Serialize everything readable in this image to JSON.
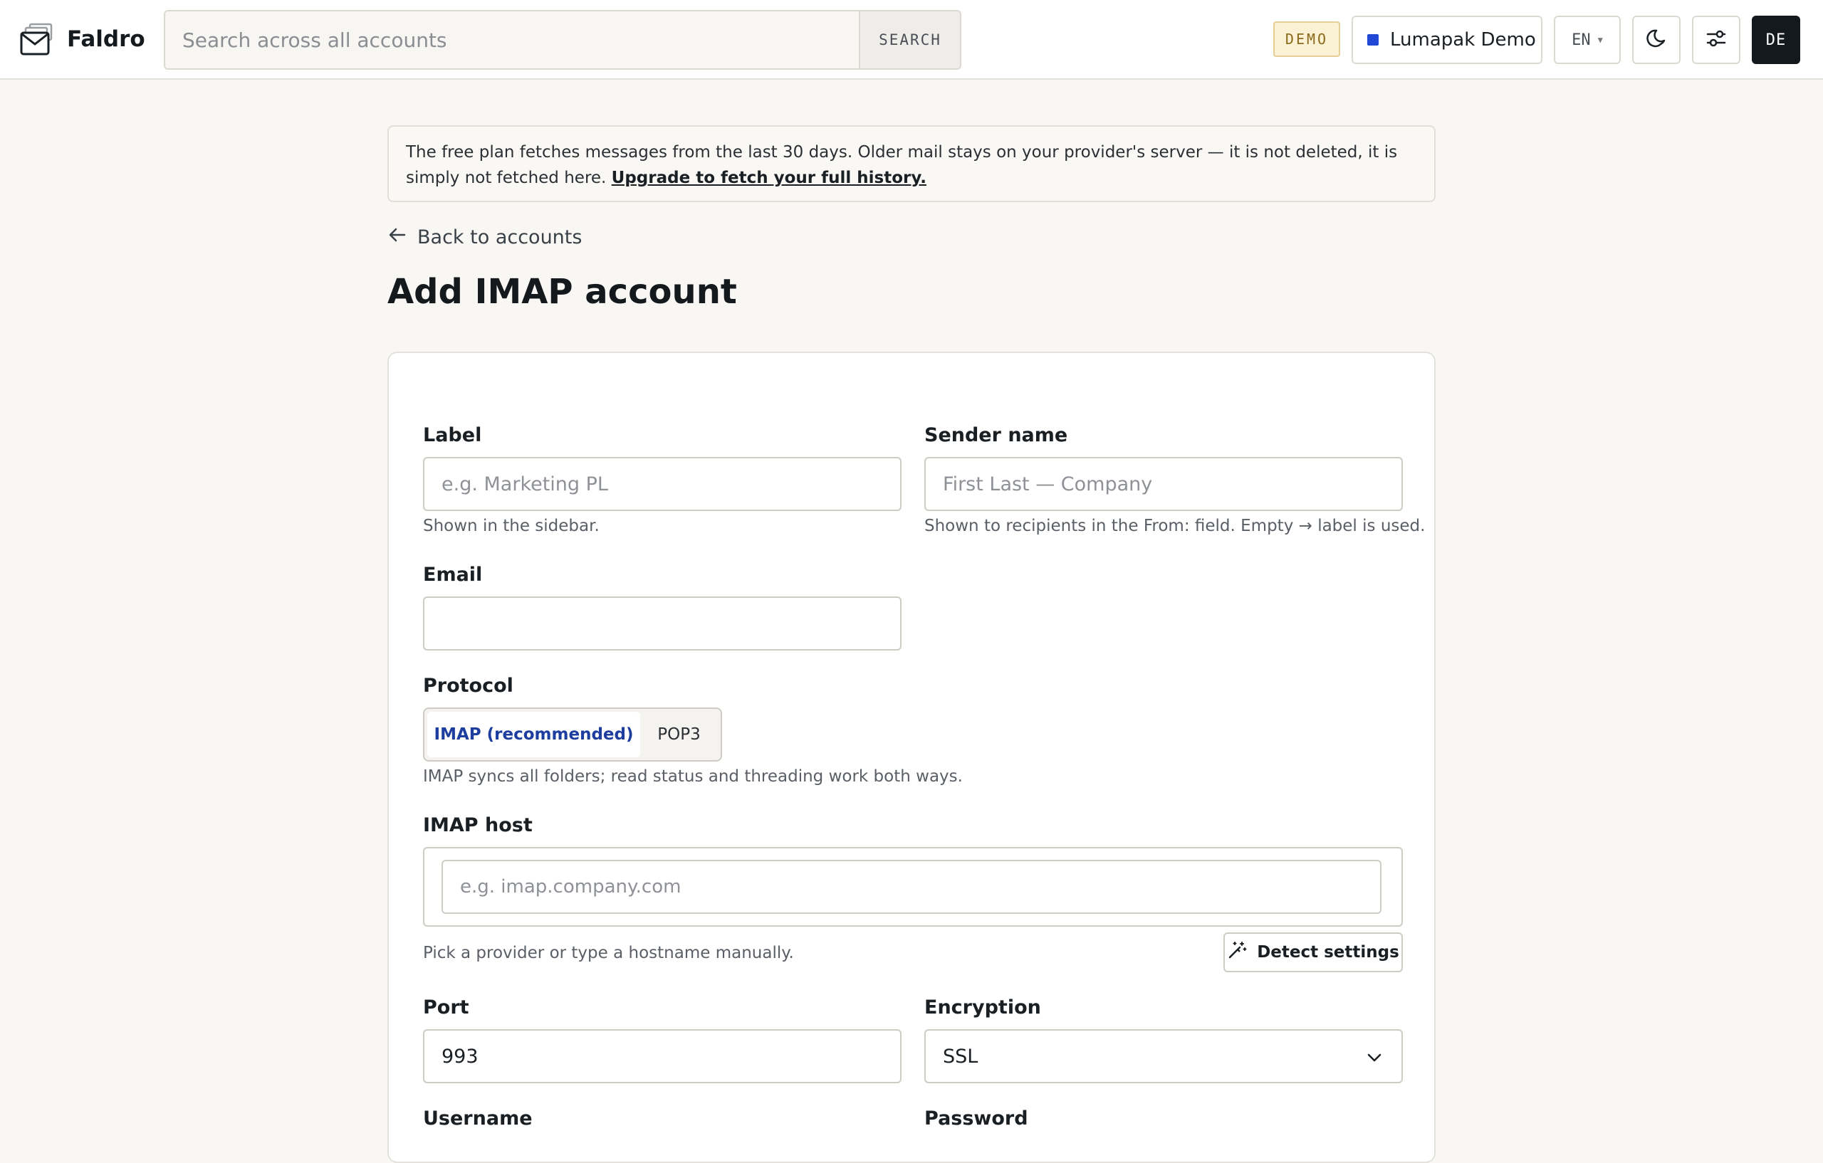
{
  "app": {
    "name": "Faldro"
  },
  "search": {
    "placeholder": "Search across all accounts",
    "button_label": "SEARCH"
  },
  "header": {
    "demo_badge": "DEMO",
    "account": {
      "name": "Lumapak Demo",
      "color": "#1f48d6"
    },
    "language": "EN",
    "avatar_initials": "DE",
    "icons": [
      "mail-logo-icon",
      "moon-icon",
      "sliders-icon",
      "chevron-down-icon"
    ]
  },
  "notice": {
    "text": "The free plan fetches messages from the last 30 days. Older mail stays on your provider's server — it is not deleted, it is simply not fetched here.",
    "link": "Upgrade to fetch your full history."
  },
  "nav": {
    "back_label": "Back to accounts"
  },
  "page": {
    "title": "Add IMAP account"
  },
  "form": {
    "label": {
      "label": "Label",
      "placeholder": "e.g. Marketing PL",
      "help": "Shown in the sidebar."
    },
    "sender_name": {
      "label": "Sender name",
      "placeholder": "First Last — Company",
      "help": "Shown to recipients in the From: field. Empty → label is used."
    },
    "email": {
      "label": "Email",
      "value": ""
    },
    "protocol": {
      "label": "Protocol",
      "options": [
        "IMAP (recommended)",
        "POP3"
      ],
      "selected": "IMAP (recommended)",
      "help": "IMAP syncs all folders; read status and threading work both ways."
    },
    "imap_host": {
      "label": "IMAP host",
      "placeholder": "e.g. imap.company.com",
      "help": "Pick a provider or type a hostname manually.",
      "detect_label": "Detect settings"
    },
    "port": {
      "label": "Port",
      "value": "993"
    },
    "encryption": {
      "label": "Encryption",
      "value": "SSL"
    },
    "username": {
      "label": "Username"
    },
    "password": {
      "label": "Password"
    }
  },
  "colors": {
    "accent": "#1d3d9f",
    "avatar_bg": "#14191e",
    "demo_badge_bg": "#fbf1d4",
    "page_bg": "#f8f7f4"
  }
}
